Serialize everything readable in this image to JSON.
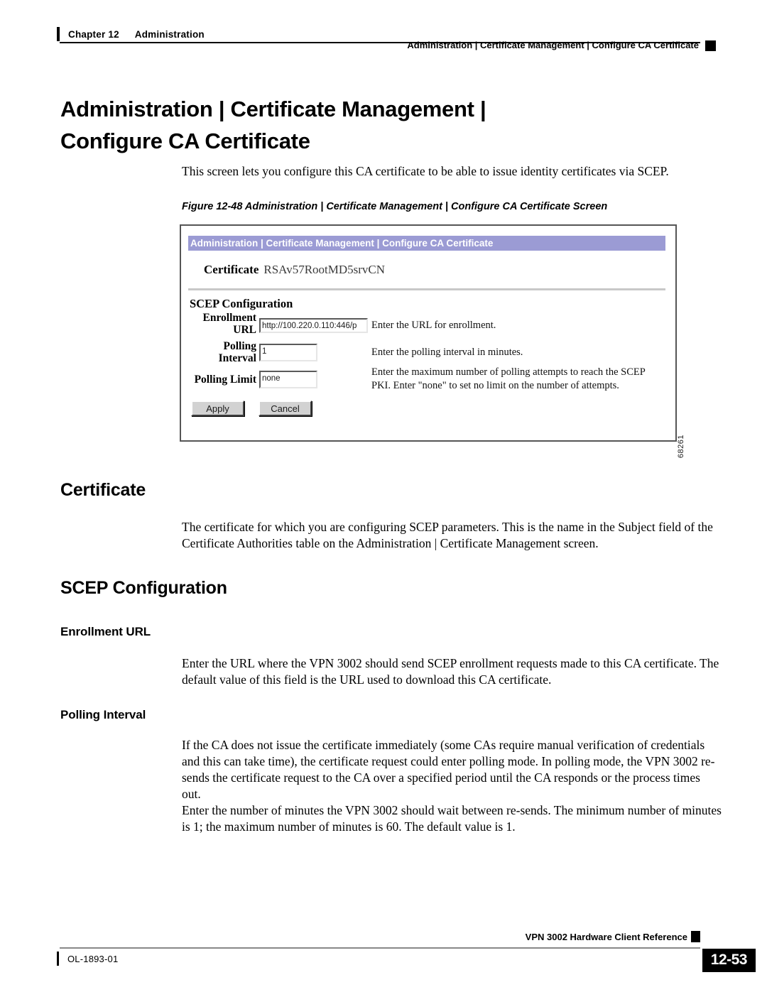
{
  "header": {
    "chapter_number": "Chapter 12",
    "chapter_title": "Administration",
    "breadcrumb": "Administration | Certificate Management | Configure CA Certificate"
  },
  "title": {
    "line1": "Administration | Certificate Management |",
    "line2": "Configure CA Certificate"
  },
  "intro": "This screen lets you configure this CA certificate to be able to issue identity certificates via SCEP.",
  "figure": {
    "caption": "Figure 12-48 Administration | Certificate Management | Configure CA Certificate Screen",
    "figure_id": "68261",
    "app": {
      "titlebar": "Administration | Certificate Management | Configure CA Certificate",
      "certificate_label": "Certificate",
      "certificate_value": "RSAv57RootMD5srvCN",
      "section_title": "SCEP Configuration",
      "fields": [
        {
          "label_line1": "Enrollment",
          "label_line2": "URL",
          "value": "http://100.220.0.110:446/p",
          "help": "Enter the URL for enrollment."
        },
        {
          "label_line1": "Polling",
          "label_line2": "Interval",
          "value": "1",
          "help": "Enter the polling interval in minutes."
        },
        {
          "label_line1": "Polling Limit",
          "label_line2": "",
          "value": "none",
          "help": "Enter the maximum number of polling attempts to reach the SCEP PKI. Enter \"none\" to set no limit on the number of attempts."
        }
      ],
      "apply_label": "Apply",
      "cancel_label": "Cancel",
      "titlebar_color": "#9b9bd4",
      "button_face_color": "#d2d2d2"
    }
  },
  "sections": {
    "certificate": {
      "heading": "Certificate",
      "body": "The certificate for which you are configuring SCEP parameters. This is the name in the Subject field of the Certificate Authorities table on the Administration | Certificate Management screen."
    },
    "scep_configuration": {
      "heading": "SCEP Configuration"
    },
    "enrollment_url": {
      "heading": "Enrollment URL",
      "body": "Enter the URL where the VPN 3002 should send SCEP enrollment requests made to this CA certificate. The default value of this field is the URL used to download this CA certificate."
    },
    "polling_interval": {
      "heading": "Polling Interval",
      "body1": "If the CA does not issue the certificate immediately (some CAs require manual verification of credentials and this can take time), the certificate request could enter polling mode. In polling mode, the VPN 3002 re-sends the certificate request to the CA over a specified period until the CA responds or the process times out.",
      "body2": "Enter the number of minutes the VPN 3002 should wait between re-sends. The minimum number of minutes is 1; the maximum number of minutes is 60. The default value is 1."
    }
  },
  "footer": {
    "book_title": "VPN 3002 Hardware Client Reference",
    "doc_id": "OL-1893-01",
    "page_number": "12-53"
  }
}
